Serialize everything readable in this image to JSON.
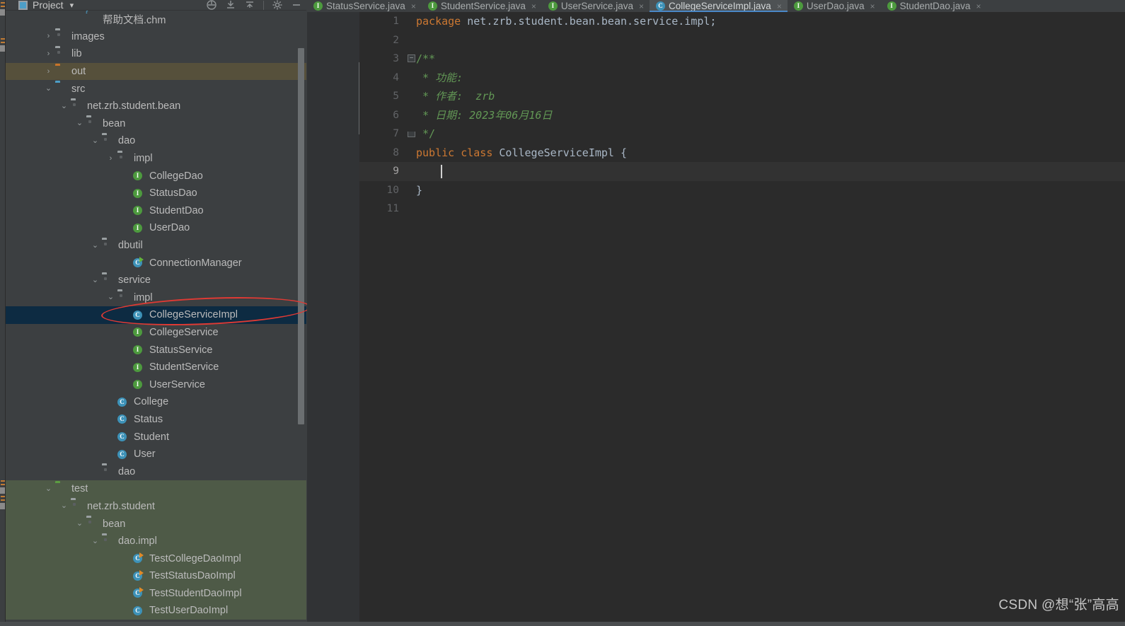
{
  "panel": {
    "title": "Project",
    "icon": "project-icon",
    "caret": "▾",
    "tools": [
      "locate-icon",
      "collapse-all-icon",
      "expand-all-icon",
      "settings-gear-icon",
      "minimize-icon"
    ]
  },
  "tabs": [
    {
      "label": "StatusService.java",
      "icon": "interface-icon",
      "iconType": "iface",
      "active": false,
      "close": "×"
    },
    {
      "label": "StudentService.java",
      "icon": "interface-icon",
      "iconType": "iface",
      "active": false,
      "close": "×"
    },
    {
      "label": "UserService.java",
      "icon": "interface-icon",
      "iconType": "iface",
      "active": false,
      "close": "×"
    },
    {
      "label": "CollegeServiceImpl.java",
      "icon": "class-icon",
      "iconType": "class",
      "active": true,
      "close": "×"
    },
    {
      "label": "UserDao.java",
      "icon": "interface-icon",
      "iconType": "iface",
      "active": false,
      "close": "×"
    },
    {
      "label": "StudentDao.java",
      "icon": "interface-icon",
      "iconType": "iface",
      "active": false,
      "close": "×"
    }
  ],
  "tree": [
    {
      "label": "帮助文档.chm",
      "indent": 4,
      "arrow": "",
      "icon": "chm-file-icon",
      "state": ""
    },
    {
      "label": "images",
      "indent": 2,
      "arrow": "›",
      "icon": "folder-grey-icon",
      "state": ""
    },
    {
      "label": "lib",
      "indent": 2,
      "arrow": "›",
      "icon": "folder-grey-icon",
      "state": ""
    },
    {
      "label": "out",
      "indent": 2,
      "arrow": "›",
      "icon": "folder-orange-icon",
      "state": "hl-out"
    },
    {
      "label": "src",
      "indent": 2,
      "arrow": "⌄",
      "icon": "folder-blue-icon",
      "state": ""
    },
    {
      "label": "net.zrb.student.bean",
      "indent": 3,
      "arrow": "⌄",
      "icon": "package-icon",
      "state": ""
    },
    {
      "label": "bean",
      "indent": 4,
      "arrow": "⌄",
      "icon": "package-icon",
      "state": ""
    },
    {
      "label": "dao",
      "indent": 5,
      "arrow": "⌄",
      "icon": "package-icon",
      "state": ""
    },
    {
      "label": "impl",
      "indent": 6,
      "arrow": "›",
      "icon": "package-icon",
      "state": ""
    },
    {
      "label": "CollegeDao",
      "indent": 7,
      "arrow": "",
      "icon": "interface-icon",
      "state": ""
    },
    {
      "label": "StatusDao",
      "indent": 7,
      "arrow": "",
      "icon": "interface-icon",
      "state": ""
    },
    {
      "label": "StudentDao",
      "indent": 7,
      "arrow": "",
      "icon": "interface-icon",
      "state": ""
    },
    {
      "label": "UserDao",
      "indent": 7,
      "arrow": "",
      "icon": "interface-icon",
      "state": ""
    },
    {
      "label": "dbutil",
      "indent": 5,
      "arrow": "⌄",
      "icon": "package-icon",
      "state": ""
    },
    {
      "label": "ConnectionManager",
      "indent": 7,
      "arrow": "",
      "icon": "class-run-icon",
      "state": ""
    },
    {
      "label": "service",
      "indent": 5,
      "arrow": "⌄",
      "icon": "package-icon",
      "state": ""
    },
    {
      "label": "impl",
      "indent": 6,
      "arrow": "⌄",
      "icon": "package-icon",
      "state": ""
    },
    {
      "label": "CollegeServiceImpl",
      "indent": 7,
      "arrow": "",
      "icon": "class-icon",
      "state": "sel"
    },
    {
      "label": "CollegeService",
      "indent": 7,
      "arrow": "",
      "icon": "interface-icon",
      "state": ""
    },
    {
      "label": "StatusService",
      "indent": 7,
      "arrow": "",
      "icon": "interface-icon",
      "state": ""
    },
    {
      "label": "StudentService",
      "indent": 7,
      "arrow": "",
      "icon": "interface-icon",
      "state": ""
    },
    {
      "label": "UserService",
      "indent": 7,
      "arrow": "",
      "icon": "interface-icon",
      "state": ""
    },
    {
      "label": "College",
      "indent": 6,
      "arrow": "",
      "icon": "class-icon",
      "state": ""
    },
    {
      "label": "Status",
      "indent": 6,
      "arrow": "",
      "icon": "class-icon",
      "state": ""
    },
    {
      "label": "Student",
      "indent": 6,
      "arrow": "",
      "icon": "class-icon",
      "state": ""
    },
    {
      "label": "User",
      "indent": 6,
      "arrow": "",
      "icon": "class-icon",
      "state": ""
    },
    {
      "label": "dao",
      "indent": 5,
      "arrow": "",
      "icon": "package-icon",
      "state": ""
    },
    {
      "label": "test",
      "indent": 2,
      "arrow": "⌄",
      "icon": "folder-green-icon",
      "state": "test"
    },
    {
      "label": "net.zrb.student",
      "indent": 3,
      "arrow": "⌄",
      "icon": "package-icon",
      "state": "test"
    },
    {
      "label": "bean",
      "indent": 4,
      "arrow": "⌄",
      "icon": "package-icon",
      "state": "test"
    },
    {
      "label": "dao.impl",
      "indent": 5,
      "arrow": "⌄",
      "icon": "package-icon",
      "state": "test"
    },
    {
      "label": "TestCollegeDaoImpl",
      "indent": 7,
      "arrow": "",
      "icon": "class-test-icon",
      "state": "test"
    },
    {
      "label": "TestStatusDaoImpl",
      "indent": 7,
      "arrow": "",
      "icon": "class-test-icon",
      "state": "test"
    },
    {
      "label": "TestStudentDaoImpl",
      "indent": 7,
      "arrow": "",
      "icon": "class-test-icon",
      "state": "test"
    },
    {
      "label": "TestUserDaoImpl",
      "indent": 7,
      "arrow": "",
      "icon": "class-icon",
      "state": "test"
    }
  ],
  "code": {
    "lines": [
      {
        "n": "1",
        "current": false,
        "fold": "",
        "segments": [
          {
            "t": "package ",
            "c": "k"
          },
          {
            "t": "net.zrb.student.bean.bean.service.impl;",
            "c": "id"
          }
        ]
      },
      {
        "n": "2",
        "current": false,
        "fold": "",
        "segments": []
      },
      {
        "n": "3",
        "current": false,
        "fold": "minus",
        "segments": [
          {
            "t": "/**",
            "c": "cmf"
          }
        ]
      },
      {
        "n": "4",
        "current": false,
        "fold": "",
        "segments": [
          {
            "t": " * 功能:",
            "c": "cm"
          }
        ]
      },
      {
        "n": "5",
        "current": false,
        "fold": "",
        "segments": [
          {
            "t": " * 作者:  zrb",
            "c": "cm"
          }
        ]
      },
      {
        "n": "6",
        "current": false,
        "fold": "",
        "segments": [
          {
            "t": " * 日期: 2023年06月16日",
            "c": "cm"
          }
        ]
      },
      {
        "n": "7",
        "current": false,
        "fold": "end",
        "segments": [
          {
            "t": " */",
            "c": "cmf"
          }
        ]
      },
      {
        "n": "8",
        "current": false,
        "fold": "",
        "segments": [
          {
            "t": "public class ",
            "c": "k"
          },
          {
            "t": "CollegeServiceImpl ",
            "c": "id"
          },
          {
            "t": "{",
            "c": "pn"
          }
        ]
      },
      {
        "n": "9",
        "current": true,
        "fold": "",
        "segments": [],
        "caret": true
      },
      {
        "n": "10",
        "current": false,
        "fold": "",
        "segments": [
          {
            "t": "}",
            "c": "pn"
          }
        ]
      },
      {
        "n": "11",
        "current": false,
        "fold": "",
        "segments": []
      }
    ]
  },
  "watermark": "CSDN @想“张”高高",
  "colors": {
    "selection": "#0d2b42",
    "out_highlight": "#56503b",
    "test_highlight": "#4e5a47",
    "annotation": "#e03a34",
    "tab_active_underline": "#4a88c7",
    "editor_bg": "#2b2b2b",
    "panel_bg": "#3c3f41",
    "keyword": "#cc7832",
    "comment": "#629755",
    "identifier": "#a9b7c6"
  }
}
